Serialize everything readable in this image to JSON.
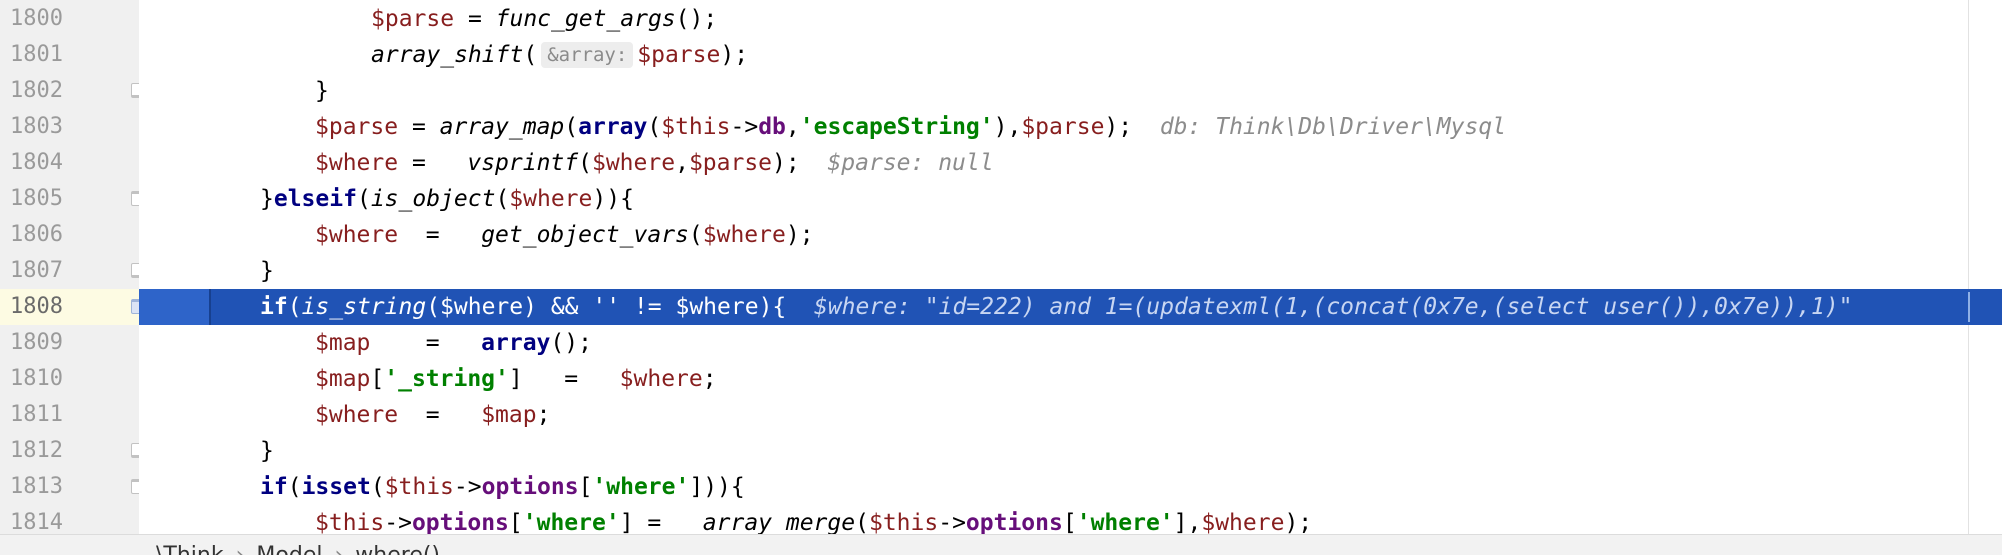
{
  "gutter": {
    "line_numbers": [
      "1800",
      "1801",
      "1802",
      "1803",
      "1804",
      "1805",
      "1806",
      "1807",
      "1808",
      "1809",
      "1810",
      "1811",
      "1812",
      "1813",
      "1814"
    ]
  },
  "code": {
    "l1800": {
      "a": "$parse",
      "b": " = ",
      "c": "func_get_args",
      "d": "();"
    },
    "l1801": {
      "a": "array_shift",
      "b": "(",
      "hint": "&array:",
      "c": "$parse",
      "d": ");"
    },
    "l1802": {
      "a": "}"
    },
    "l1803": {
      "a": "$parse",
      "b": " = ",
      "c": "array_map",
      "d": "(",
      "e": "array",
      "f": "(",
      "g": "$this",
      "h": "->",
      "i": "db",
      "j": ",",
      "k": "'escapeString'",
      "l": "),",
      "m": "$parse",
      "n": ");",
      "hint": "db: Think\\Db\\Driver\\Mysql"
    },
    "l1804": {
      "a": "$where",
      "b": " =   ",
      "c": "vsprintf",
      "d": "(",
      "e": "$where",
      "f": ",",
      "g": "$parse",
      "h": ");",
      "hint": "$parse: null"
    },
    "l1805": {
      "a": "}",
      "b": "elseif",
      "c": "(",
      "d": "is_object",
      "e": "(",
      "f": "$where",
      "g": ")){"
    },
    "l1806": {
      "a": "$where",
      "b": "  =   ",
      "c": "get_object_vars",
      "d": "(",
      "e": "$where",
      "f": ");"
    },
    "l1807": {
      "a": "}"
    },
    "l1808": {
      "a": "if",
      "b": "(",
      "c": "is_string",
      "d": "(",
      "e": "$where",
      "f": ") && '' != ",
      "g": "$where",
      "h": "){",
      "hint": "$where: \"id=222) and 1=(updatexml(1,(concat(0x7e,(select user()),0x7e)),1)\""
    },
    "l1809": {
      "a": "$map",
      "b": "    =   ",
      "c": "array",
      "d": "();"
    },
    "l1810": {
      "a": "$map",
      "b": "[",
      "c": "'_string'",
      "d": "]   =   ",
      "e": "$where",
      "f": ";"
    },
    "l1811": {
      "a": "$where",
      "b": "  =   ",
      "c": "$map",
      "d": ";"
    },
    "l1812": {
      "a": "}"
    },
    "l1813": {
      "a": "if",
      "b": "(",
      "c": "isset",
      "d": "(",
      "e": "$this",
      "f": "->",
      "g": "options",
      "h": "[",
      "i": "'where'",
      "j": "])){"
    },
    "l1814": {
      "a": "$this",
      "b": "->",
      "c": "options",
      "d": "[",
      "e": "'where'",
      "f": "] =   ",
      "g": "array_merge",
      "h": "(",
      "i": "$this",
      "j": "->",
      "k": "options",
      "l": "[",
      "m": "'where'",
      "n": "],",
      "o": "$where",
      "p": ");"
    }
  },
  "breadcrumb": {
    "items": [
      "\\Think",
      "Model",
      "where()"
    ],
    "separator": "›"
  },
  "colors": {
    "execution_line": "#2053b5",
    "keyword": "#000080",
    "string": "#008000",
    "variable": "#871e1e"
  }
}
